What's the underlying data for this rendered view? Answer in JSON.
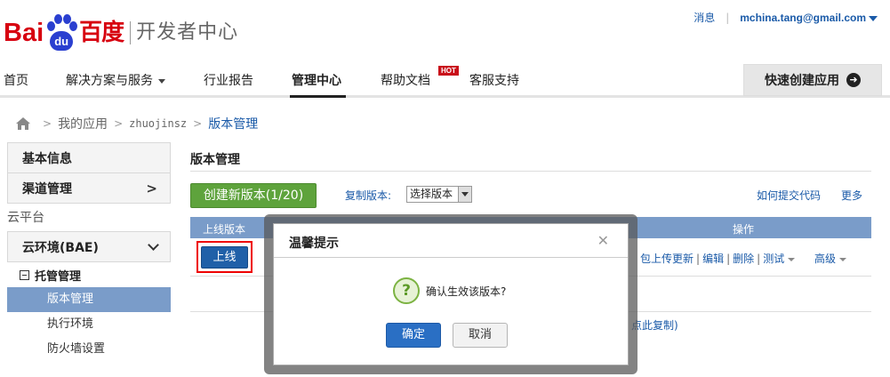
{
  "logo": {
    "latin": "Bai",
    "pad_text": "du",
    "chinese": "百度",
    "subtitle": "开发者中心"
  },
  "header": {
    "message_link": "消息",
    "separator": "|",
    "user_email": "mchina.tang@gmail.com"
  },
  "nav": {
    "items": [
      "首页",
      "解决方案与服务",
      "行业报告",
      "管理中心",
      "帮助文档",
      "客服支持"
    ],
    "active": "管理中心",
    "hot_badge": "HOT",
    "quick_create": "快速创建应用"
  },
  "breadcrumb": {
    "my_apps": "我的应用",
    "app_name": "zhuojinsz",
    "current": "版本管理",
    "separator": ">"
  },
  "sidebar": {
    "basic_info": "基本信息",
    "channel_manage": "渠道管理",
    "cloud_platform": "云平台",
    "cloud_env": "云环境(BAE)",
    "hosting_manage": "托管管理",
    "leaf_items": [
      "版本管理",
      "执行环境",
      "防火墙设置"
    ],
    "active_leaf": "版本管理"
  },
  "main": {
    "title": "版本管理",
    "create_button": "创建新版本(1/20)",
    "copy_version_label": "复制版本:",
    "copy_version_select": "选择版本",
    "how_to_submit": "如何提交代码",
    "more": "更多",
    "table_headers": [
      "上线版本",
      "操作"
    ],
    "online_button": "上线",
    "row_actions": {
      "upload_update": "包上传更新",
      "edit": "编辑",
      "delete": "删除",
      "test": "测试",
      "advanced": "高级",
      "separator": "|"
    },
    "copy_hint": "点此复制)"
  },
  "dialog": {
    "title": "温馨提示",
    "close_glyph": "✕",
    "question_glyph": "?",
    "message": "确认生效该版本?",
    "confirm": "确定",
    "cancel": "取消"
  },
  "colors": {
    "brand_red": "#d7000f",
    "brand_blue": "#2a3fd0",
    "link_blue": "#1a5aa8",
    "table_header": "#7a9cc9",
    "create_green": "#5ea33c",
    "primary_button": "#2a6fc4",
    "highlight_outline": "#e00000"
  }
}
